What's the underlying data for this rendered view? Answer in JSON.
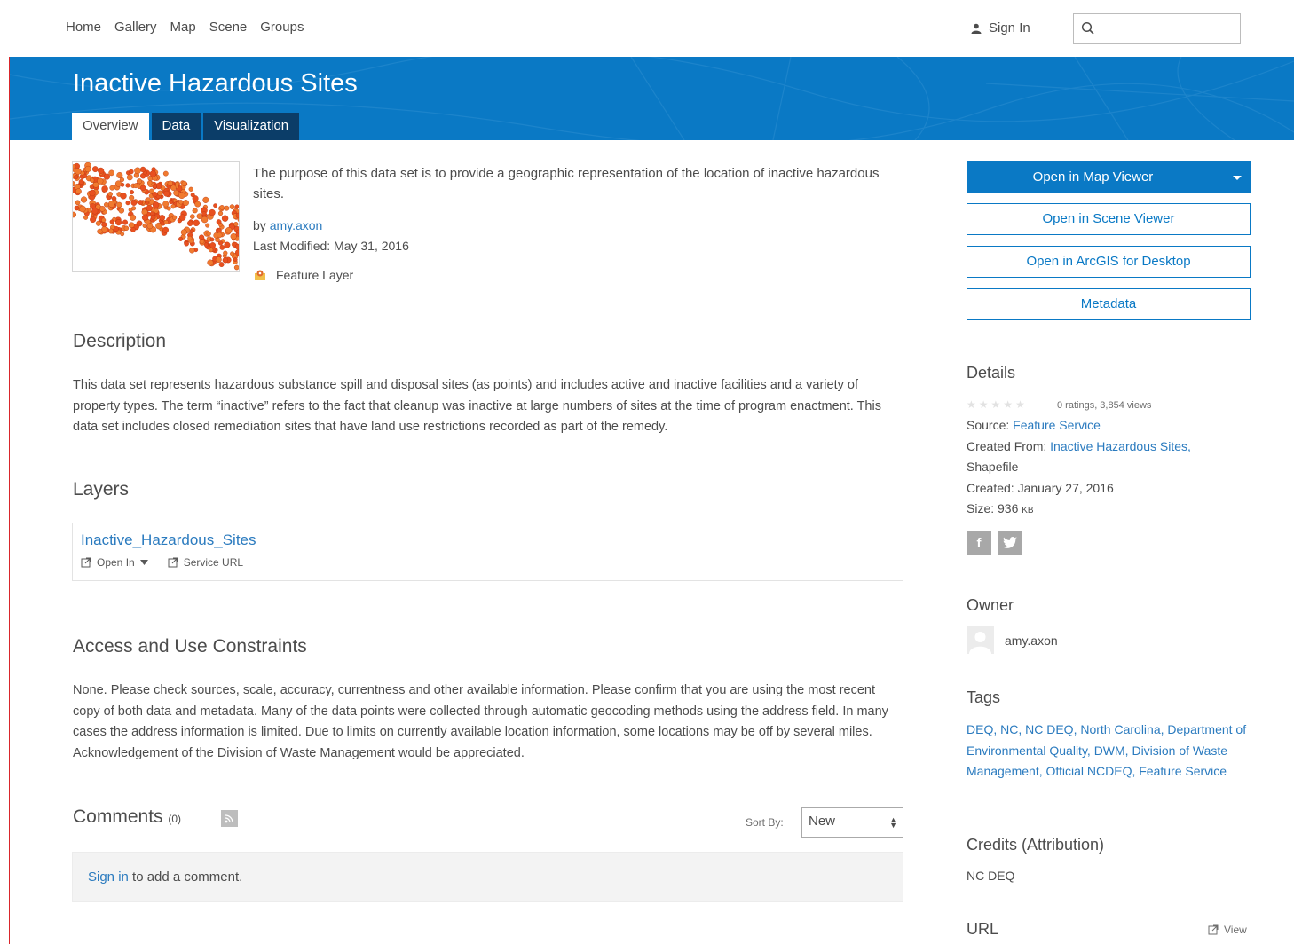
{
  "nav": {
    "links": [
      "Home",
      "Gallery",
      "Map",
      "Scene",
      "Groups"
    ],
    "sign_in": "Sign In",
    "search_placeholder": ""
  },
  "banner": {
    "title": "Inactive Hazardous Sites",
    "tabs": [
      "Overview",
      "Data",
      "Visualization"
    ],
    "active_tab": "Overview",
    "color": "#0a79c5"
  },
  "summary": {
    "text": "The purpose of this data set is to provide a geographic representation of the location of inactive hazardous sites.",
    "by_label": "by",
    "author": "amy.axon",
    "last_modified": "Last Modified: May 31, 2016",
    "item_type": "Feature Layer"
  },
  "description": {
    "heading": "Description",
    "text": "This data set represents hazardous substance spill and disposal sites (as points) and includes active and inactive facilities and a variety of property types. The term “inactive” refers to the fact that cleanup was inactive at large numbers of sites at the time of program enactment. This data set includes closed remediation sites that have land use restrictions recorded as part of the remedy."
  },
  "layers": {
    "heading": "Layers",
    "name": "Inactive_Hazardous_Sites",
    "open_in": "Open In",
    "service_url": "Service URL"
  },
  "constraints": {
    "heading": "Access and Use Constraints",
    "text": "None. Please check sources, scale, accuracy, currentness and other available information. Please confirm that you are using the most recent copy of both data and metadata. Many of the data points were collected through automatic geocoding methods using the address field. In many cases the address information is limited. Due to limits on currently available location information, some locations may be off by several miles. Acknowledgement of the Division of Waste Management would be appreciated."
  },
  "comments": {
    "heading": "Comments",
    "count": "(0)",
    "sort_label": "Sort By:",
    "sort_value": "New",
    "sign_in_link": "Sign in",
    "sign_in_suffix": " to add a comment."
  },
  "actions": {
    "open_map_viewer": "Open in Map Viewer",
    "open_scene_viewer": "Open in Scene Viewer",
    "open_desktop": "Open in ArcGIS for Desktop",
    "metadata": "Metadata"
  },
  "details": {
    "heading": "Details",
    "ratings": "0 ratings, 3,854 views",
    "rating_value": 0,
    "rating_max": 5,
    "source_label": "Source:",
    "source_value": "Feature Service",
    "created_from_label": "Created From:",
    "created_from_value": "Inactive Hazardous Sites,",
    "created_from_extra": "Shapefile",
    "created": "Created: January 27, 2016",
    "size_label": "Size: 936",
    "size_unit": "KB"
  },
  "owner": {
    "heading": "Owner",
    "name": "amy.axon"
  },
  "tags": {
    "heading": "Tags",
    "text": "DEQ, NC, NC DEQ, North Carolina, Department of Environmental Quality, DWM, Division of Waste Management, Official NCDEQ, Feature Service"
  },
  "credits": {
    "heading": "Credits (Attribution)",
    "text": "NC DEQ"
  },
  "url": {
    "heading": "URL",
    "view": "View"
  }
}
